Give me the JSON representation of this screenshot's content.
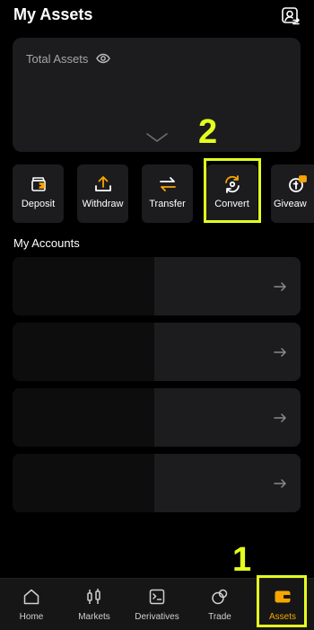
{
  "header": {
    "title": "My Assets"
  },
  "assets_card": {
    "label": "Total Assets"
  },
  "actions": [
    {
      "label": "Deposit"
    },
    {
      "label": "Withdraw"
    },
    {
      "label": "Transfer"
    },
    {
      "label": "Convert"
    },
    {
      "label": "Giveaw"
    }
  ],
  "accounts": {
    "title": "My Accounts"
  },
  "steps": {
    "one": "1",
    "two": "2"
  },
  "nav": [
    {
      "label": "Home"
    },
    {
      "label": "Markets"
    },
    {
      "label": "Derivatives"
    },
    {
      "label": "Trade"
    },
    {
      "label": "Assets"
    }
  ],
  "colors": {
    "accent": "#f7a600",
    "highlight": "#e4ff1f",
    "card": "#1c1c1e"
  }
}
